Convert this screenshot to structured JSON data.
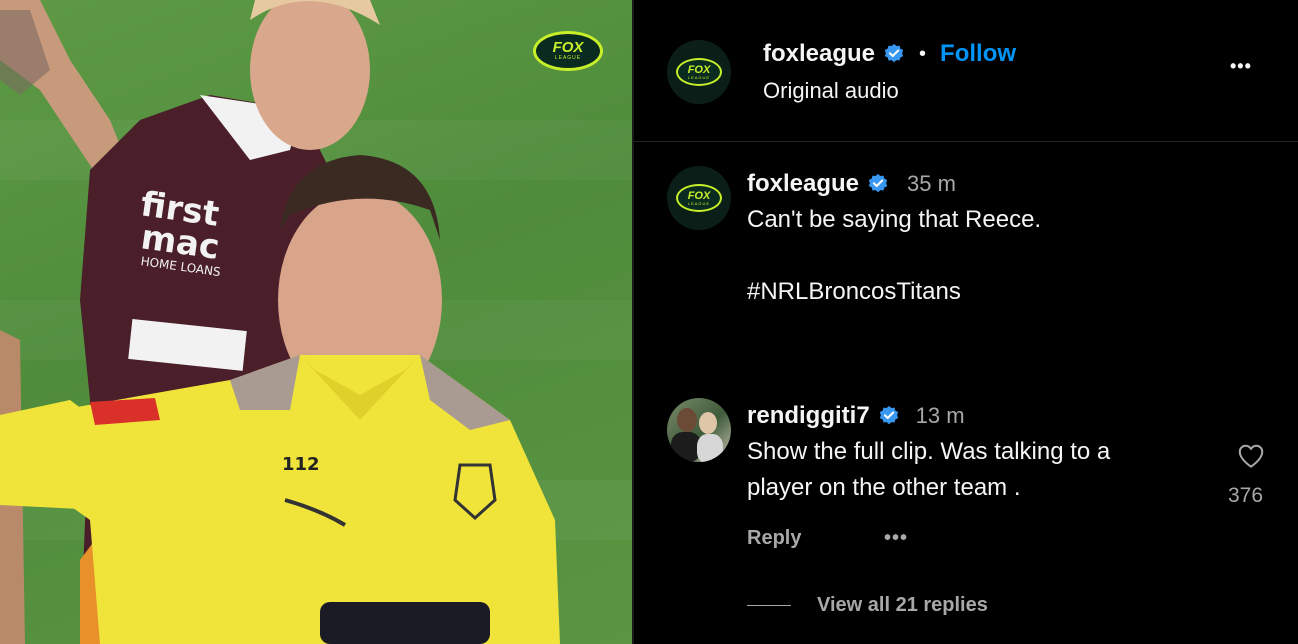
{
  "video": {
    "brand_logo_text": "FOX",
    "brand_logo_sub": "LEAGUE"
  },
  "post_header": {
    "username": "foxleague",
    "separator": "•",
    "follow_label": "Follow",
    "audio_label": "Original audio",
    "more_label": "•••"
  },
  "caption": {
    "username": "foxleague",
    "time": "35 m",
    "text": "Can't be saying that Reece.",
    "hashtag": "#NRLBroncosTitans"
  },
  "comment": {
    "username": "rendiggiti7",
    "time": "13 m",
    "line1": "Show the full clip. Was talking to a",
    "line2": "player on the other team .",
    "likes": "376",
    "reply_label": "Reply",
    "more_label": "•••",
    "view_replies_label": "View all 21 replies"
  },
  "colors": {
    "accent_blue": "#0095f6",
    "verified_blue": "#3897f0",
    "fox_green": "#c8f02a",
    "background": "#000000",
    "muted_text": "#a8a8a8"
  },
  "icons": [
    "verified-badge-icon",
    "heart-icon",
    "more-icon"
  ]
}
